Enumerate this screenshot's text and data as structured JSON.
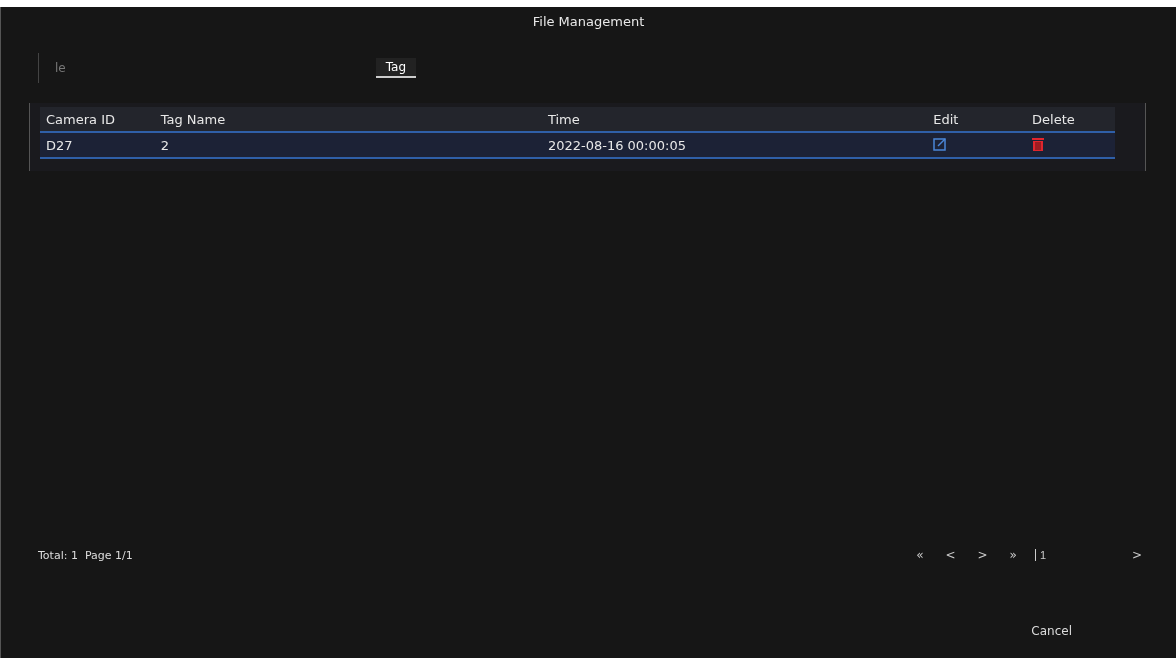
{
  "window": {
    "title": "File Management"
  },
  "tabs": [
    {
      "label": "le",
      "selected": false
    },
    {
      "label": "Tag",
      "selected": true
    }
  ],
  "table": {
    "columns": [
      "Camera ID",
      "Tag Name",
      "Time",
      "Edit",
      "Delete"
    ],
    "rows": [
      {
        "camera_id": "D27",
        "tag_name": "2",
        "time": "2022-08-16 00:00:05",
        "selected": true
      }
    ]
  },
  "footer": {
    "summary": "Total: 1  Page 1/1",
    "pager": [
      "«",
      "<",
      ">",
      "»"
    ],
    "page_value": "1",
    "go": ">"
  },
  "buttons": [
    "Cancel"
  ]
}
